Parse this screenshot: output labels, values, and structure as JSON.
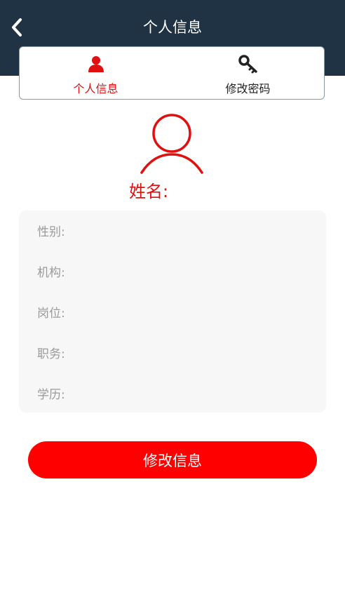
{
  "header": {
    "title": "个人信息",
    "back_icon": "chevron-left-icon"
  },
  "tabs": [
    {
      "label": "个人信息",
      "icon": "user-icon",
      "active": true
    },
    {
      "label": "修改密码",
      "icon": "key-icon",
      "active": false
    }
  ],
  "profile": {
    "avatar_icon": "user-outline-icon",
    "name_label": "姓名:"
  },
  "info": {
    "gender_label": "性别:",
    "org_label": "机构:",
    "post_label": "岗位:",
    "duty_label": "职务:",
    "education_label": "学历:"
  },
  "actions": {
    "edit_label": "修改信息"
  },
  "colors": {
    "header_bg": "#1f3344",
    "accent": "#e01010",
    "button": "#ff0000",
    "card_bg": "#f7f7f7"
  }
}
